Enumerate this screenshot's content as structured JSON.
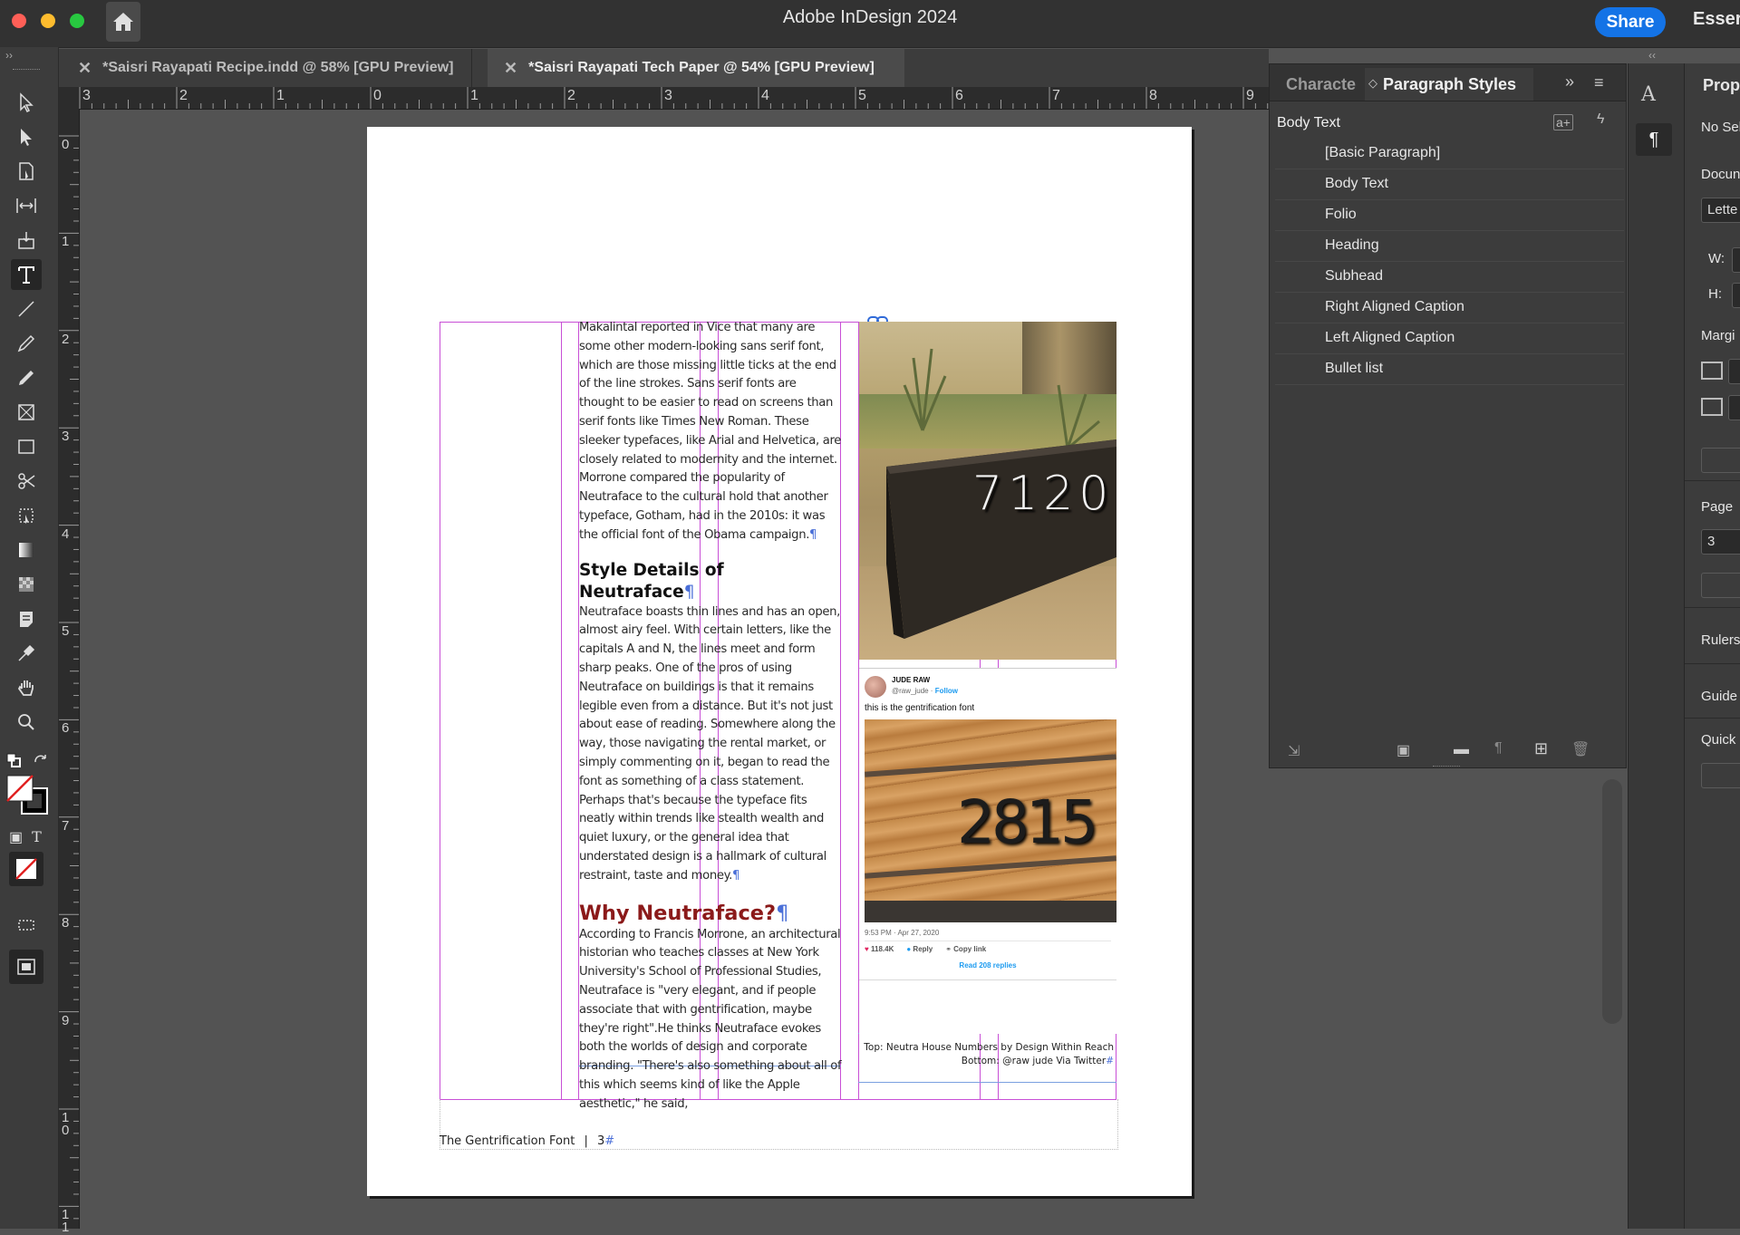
{
  "app": {
    "title": "Adobe InDesign 2024",
    "share_label": "Share",
    "workspace_label": "Esser"
  },
  "tabs": [
    {
      "label": "*Saisri Rayapati Recipe.indd @ 58% [GPU Preview]",
      "close": "✕"
    },
    {
      "label": "*Saisri Rayapati Tech Paper @ 54% [GPU Preview]",
      "close": "✕"
    }
  ],
  "ruler": {
    "horizontal": [
      "3",
      "2",
      "1",
      "0",
      "1",
      "2",
      "3",
      "4",
      "5",
      "6",
      "7",
      "8",
      "9"
    ],
    "vertical": [
      "0",
      "1",
      "2",
      "3",
      "4",
      "5",
      "6",
      "7",
      "8",
      "9",
      "1\n0",
      "1\n1"
    ]
  },
  "document": {
    "para1": "Makalintal reported in Vice that many are some other modern-looking sans serif font, which are those missing little ticks at the end of the line strokes. Sans serif fonts are thought to be easier to read on screens than serif fonts like Times New Roman. These sleeker typefaces, like Arial and Helvetica, are closely related to modernity and the internet. Morrone compared the popularity of Neutraface to the cultural hold that another typeface, Gotham, had in the 2010s: it was the official font of the Obama campaign.",
    "heading1": "Style Details of Neutraface",
    "para2": "Neutraface boasts thin lines and has an open, almost airy feel. With certain letters, like the capitals A and N, the lines meet and form sharp peaks. One of the pros of using Neutraface on buildings is that it remains legible even from a distance. But it's not just about ease of reading. Somewhere along the way, those navigating the rental market, or simply commenting on it, began to read the font as something of a class statement. Perhaps that's because the typeface fits neatly within trends like stealth wealth and quiet luxury, or the general idea that understated design is a hallmark of cultural restraint, taste and money.",
    "heading2": "Why Neutraface?",
    "para3": "According to Francis Morrone, an architectural historian who teaches classes at New York University's School of Professional Studies, Neutraface is \"very elegant, and if people associate that with gentrification, maybe they're right\".He thinks Neutraface evokes both the worlds of design and corporate branding. \"There's also something about all of this which seems kind of like the Apple aesthetic,\" he said,",
    "pilcrow": "¶",
    "house_number_top": "7120",
    "house_number_bottom": "2815",
    "tweet": {
      "name": "JUDE RAW",
      "handle": "@raw_jude · ",
      "follow": "Follow",
      "text": "this is the gentrification font",
      "time": "9:53 PM · Apr 27, 2020",
      "likes": "118.4K",
      "reply": "Reply",
      "copy": "Copy link",
      "read": "Read 208 replies"
    },
    "caption_top": "Top: Neutra House Numbers by Design Within Reach",
    "caption_bottom": "Bottom: @raw jude Via Twitter",
    "footer_title": "The Gentrification Font",
    "footer_sep": "|",
    "footer_page": "3"
  },
  "paragraph_styles_panel": {
    "tab_character": "Characte",
    "tab_paragraph": "Paragraph Styles",
    "current_style": "Body Text",
    "styles": [
      "[Basic Paragraph]",
      "Body Text",
      "Folio",
      "Heading",
      "Subhead",
      "Right Aligned Caption",
      "Left Aligned Caption",
      "Bullet list"
    ]
  },
  "properties_panel": {
    "title": "Prop",
    "no_selection": "No Sel",
    "document": "Docun",
    "preset": "Lette",
    "w_label": "W:",
    "h_label": "H:",
    "margins": "Margi",
    "page_label": "Page",
    "page_value": "3",
    "rulers": "Rulers",
    "guides": "Guide",
    "quick": "Quick"
  },
  "colors": {
    "heading_dark_red": "#8b1a1a",
    "guide_magenta": "#c84fd6",
    "share_blue": "#1473e6"
  }
}
